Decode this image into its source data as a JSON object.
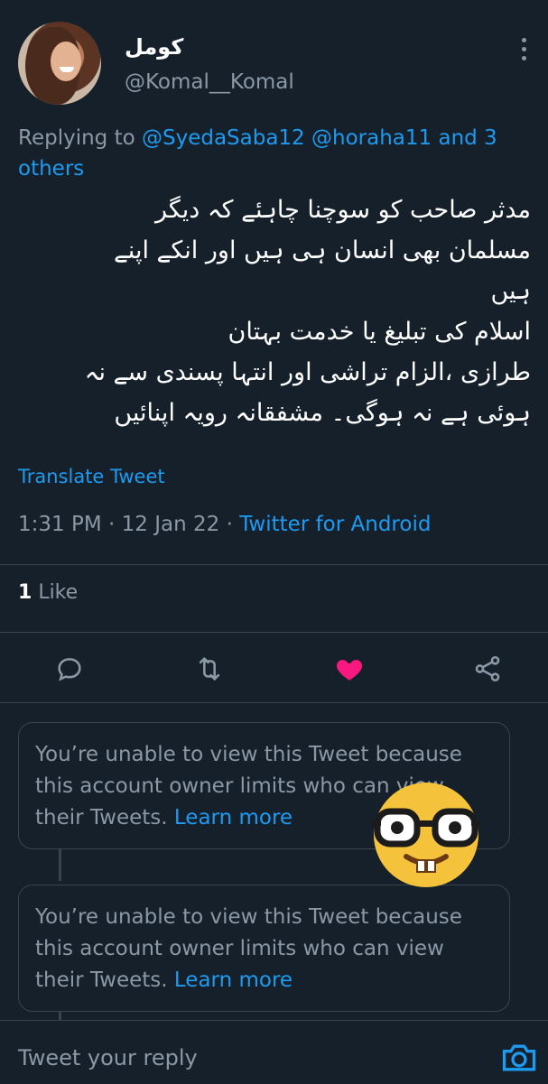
{
  "tweet": {
    "author_name": "کومل",
    "author_handle": "@Komal__Komal",
    "replying_prefix": "Replying to",
    "replying_users": "@SyedaSaba12 @horaha11",
    "replying_and": "and 3",
    "replying_others": "others",
    "text": "مدثر صاحب کو سوچنا چاہئے کہ دیگر\nمسلمان بھی انسان ہی ہیں اور انکے اپنے\nہیں\nاسلام کی تبلیغ یا خدمت بہتان\nطرازی ،الزام تراشی اور انتہا پسندی سے نہ\nہوئی ہے نہ ہوگی۔ مشفقانہ رویہ اپنائیں",
    "translate_label": "Translate Tweet",
    "time": "1:31 PM",
    "date": "12 Jan 22",
    "source": "Twitter for Android",
    "likes_count": "1",
    "likes_label": "Like"
  },
  "hidden_tweets": [
    {
      "text": "You’re unable to view this Tweet because this account owner limits who can view their Tweets.",
      "link": "Learn more"
    },
    {
      "text": "You’re unable to view this Tweet because this account owner limits who can view their Tweets.",
      "link": "Learn more"
    }
  ],
  "reply_bar": {
    "placeholder": "Tweet your reply"
  },
  "colors": {
    "background": "#15202b",
    "accent": "#1d9bf0",
    "like": "#f91880",
    "muted": "#8b98a5",
    "border": "#38444d",
    "emoji": "#f5c33b"
  },
  "icons": [
    "more-icon",
    "reply-icon",
    "retweet-icon",
    "like-icon",
    "share-icon",
    "nerd-emoji",
    "camera-icon"
  ]
}
